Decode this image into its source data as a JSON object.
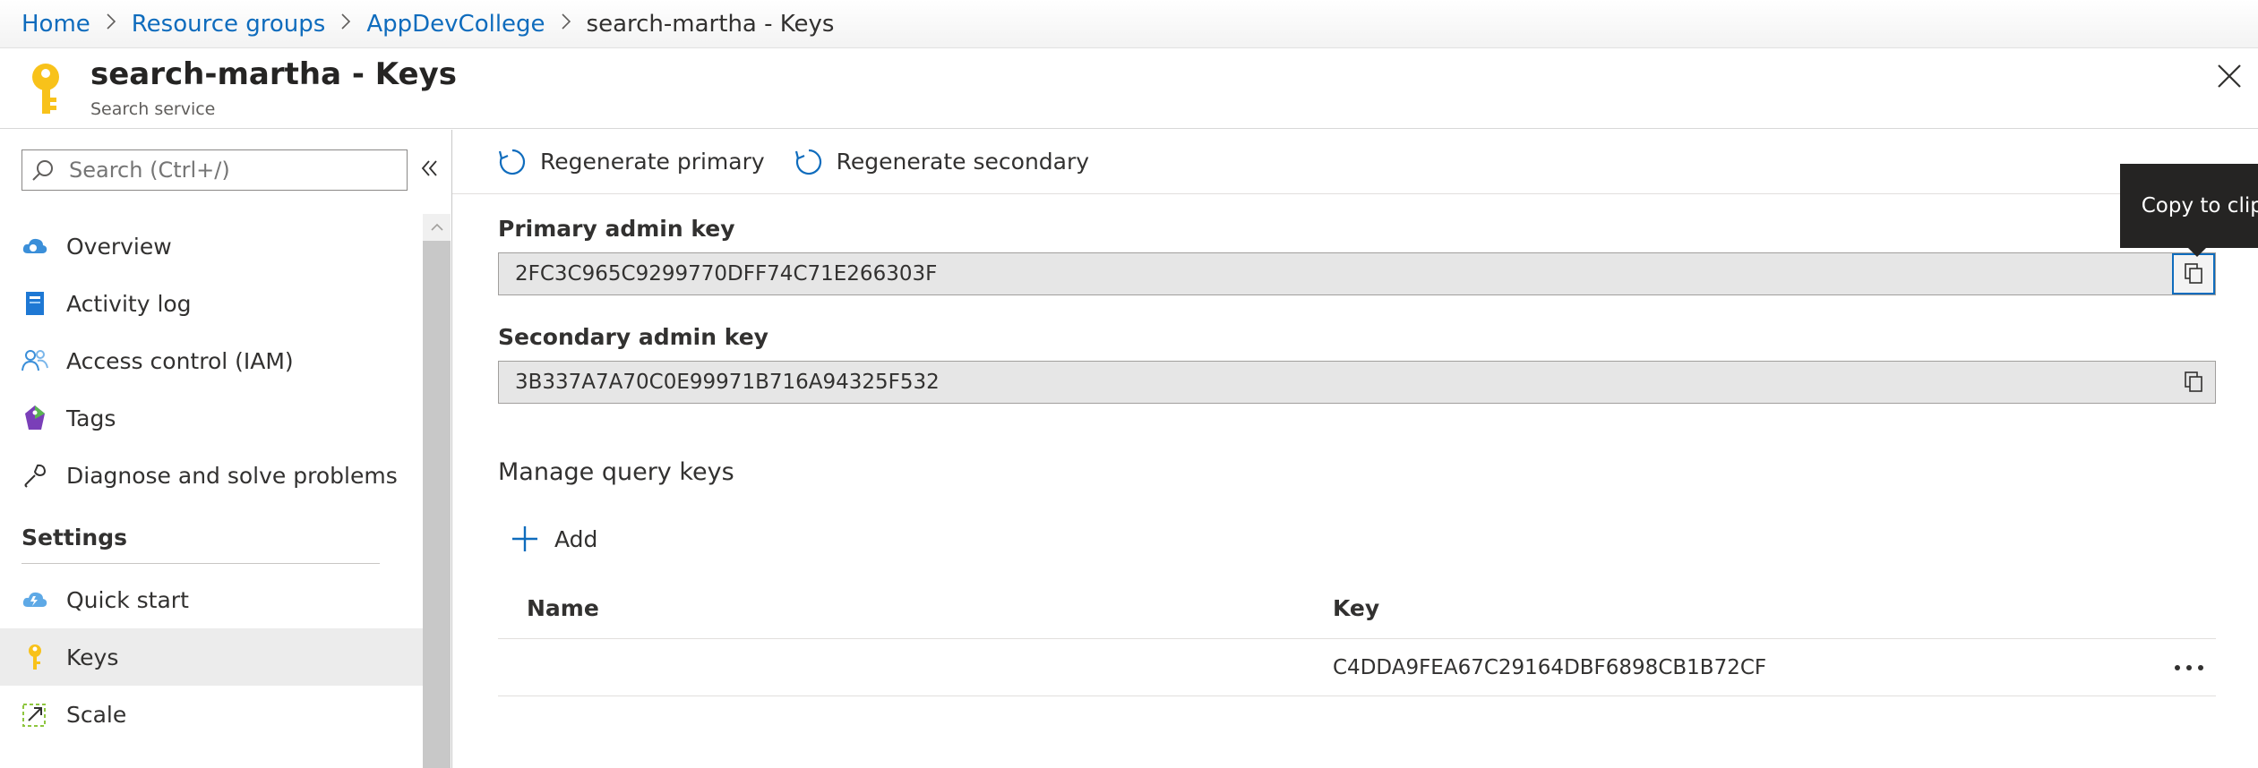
{
  "breadcrumb": {
    "items": [
      "Home",
      "Resource groups",
      "AppDevCollege"
    ],
    "current": "search-martha - Keys"
  },
  "blade": {
    "title": "search-martha - Keys",
    "subtitle": "Search service"
  },
  "leftnav": {
    "search_placeholder": "Search (Ctrl+/)",
    "items": [
      {
        "label": "Overview",
        "icon": "overview-cloud-icon"
      },
      {
        "label": "Activity log",
        "icon": "activity-log-icon"
      },
      {
        "label": "Access control (IAM)",
        "icon": "people-icon"
      },
      {
        "label": "Tags",
        "icon": "tag-icon"
      },
      {
        "label": "Diagnose and solve problems",
        "icon": "wrench-icon"
      }
    ],
    "settings_header": "Settings",
    "settings_items": [
      {
        "label": "Quick start",
        "icon": "quick-start-cloud-icon"
      },
      {
        "label": "Keys",
        "icon": "key-icon",
        "active": true
      },
      {
        "label": "Scale",
        "icon": "scale-icon"
      }
    ]
  },
  "toolbar": {
    "regen_primary": "Regenerate primary",
    "regen_secondary": "Regenerate secondary"
  },
  "primary": {
    "label": "Primary admin key",
    "value": "2FC3C965C9299770DFF74C71E266303F"
  },
  "secondary": {
    "label": "Secondary admin key",
    "value": "3B337A7A70C0E99971B716A94325F532"
  },
  "tooltip": {
    "text": "Copy to clipboard"
  },
  "query_keys": {
    "title": "Manage query keys",
    "add_label": "Add",
    "columns": [
      "Name",
      "Key"
    ],
    "rows": [
      {
        "name": "",
        "key": "C4DDA9FEA67C29164DBF6898CB1B72CF"
      }
    ]
  },
  "colors": {
    "accent": "#0f6cbd",
    "key_yellow": "#f8c21a",
    "tooltip_bg": "#252423"
  }
}
